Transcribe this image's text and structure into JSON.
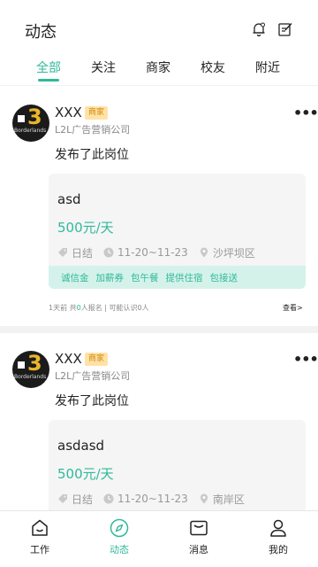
{
  "header": {
    "title": "动态",
    "icons": [
      "bell-icon",
      "edit-icon"
    ]
  },
  "tabs": [
    {
      "label": "全部",
      "active": true
    },
    {
      "label": "关注",
      "active": false
    },
    {
      "label": "商家",
      "active": false
    },
    {
      "label": "校友",
      "active": false
    },
    {
      "label": "附近",
      "active": false
    }
  ],
  "posts": [
    {
      "avatar": {
        "num": "3",
        "name": "Borderlands"
      },
      "username": "XXX",
      "badge": "商家",
      "company": "L2L广告营销公司",
      "text": "发布了此岗位",
      "job": {
        "title": "asd",
        "salary": "500元/天",
        "settlement": "日结",
        "dates": "11-20~11-23",
        "location": "沙坪坝区",
        "perks": [
          "诚信金",
          "加薪券",
          "包午餐",
          "提供住宿",
          "包接送"
        ]
      },
      "footer": {
        "time": "1天前",
        "pre": "共",
        "count": "0",
        "post": "人报名 | 可能认识0人",
        "link": "查看>"
      }
    },
    {
      "avatar": {
        "num": "3",
        "name": "Borderlands"
      },
      "username": "XXX",
      "badge": "商家",
      "company": "L2L广告营销公司",
      "text": "发布了此岗位",
      "job": {
        "title": "asdasd",
        "salary": "500元/天",
        "settlement": "日结",
        "dates": "11-20~11-23",
        "location": "南岸区"
      }
    }
  ],
  "bottom_nav": [
    {
      "label": "工作",
      "icon": "home-icon",
      "active": false
    },
    {
      "label": "动态",
      "icon": "compass-icon",
      "active": true
    },
    {
      "label": "消息",
      "icon": "mail-icon",
      "active": false
    },
    {
      "label": "我的",
      "icon": "user-icon",
      "active": false
    }
  ],
  "colors": {
    "accent": "#2fb99b",
    "badge_bg": "#ffe2a6",
    "badge_text": "#d08a10",
    "perk_bg": "#d5f2ea"
  }
}
